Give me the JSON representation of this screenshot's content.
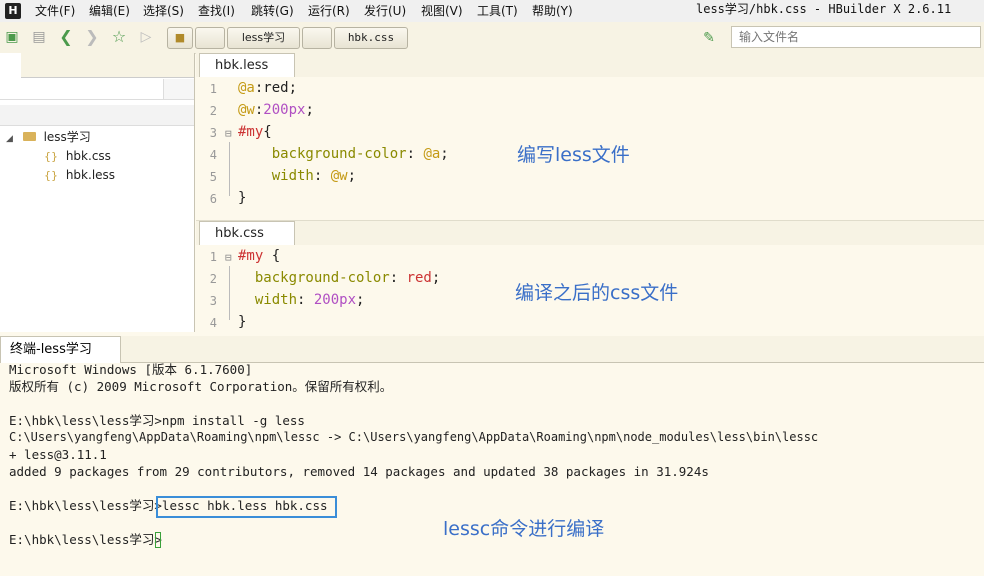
{
  "menu": {
    "logo": "H",
    "items": [
      "文件(F)",
      "编辑(E)",
      "选择(S)",
      "查找(I)",
      "跳转(G)",
      "运行(R)",
      "发行(U)",
      "视图(V)",
      "工具(T)",
      "帮助(Y)"
    ],
    "window_title": "less学习/hbk.css - HBuilder X 2.6.11"
  },
  "toolbar": {
    "project_button": "less学习",
    "file_button": "hbk.css",
    "search_placeholder": "输入文件名"
  },
  "project_tree": {
    "root": "less学习",
    "files": [
      "hbk.css",
      "hbk.less"
    ]
  },
  "editor_less": {
    "tab": "hbk.less",
    "line_numbers": [
      "1",
      "2",
      "3",
      "4",
      "5",
      "6"
    ],
    "annotation": "编写less文件"
  },
  "editor_css": {
    "tab": "hbk.css",
    "line_numbers": [
      "1",
      "2",
      "3",
      "4"
    ],
    "annotation": "编译之后的css文件"
  },
  "terminal": {
    "tab": "终端-less学习",
    "lines": [
      "Microsoft Windows [版本 6.1.7600]",
      "版权所有 (c) 2009 Microsoft Corporation。保留所有权利。",
      "",
      "E:\\hbk\\less\\less学习>npm install -g less",
      "C:\\Users\\yangfeng\\AppData\\Roaming\\npm\\lessc -> C:\\Users\\yangfeng\\AppData\\Roaming\\npm\\node_modules\\less\\bin\\lessc",
      "+ less@3.11.1",
      "added 9 packages from 29 contributors, removed 14 packages and updated 38 packages in 31.924s",
      "",
      "E:\\hbk\\less\\less学习>lessc hbk.less hbk.css",
      "",
      "E:\\hbk\\less\\less学习>"
    ],
    "annotation": "lessc命令进行编译"
  }
}
